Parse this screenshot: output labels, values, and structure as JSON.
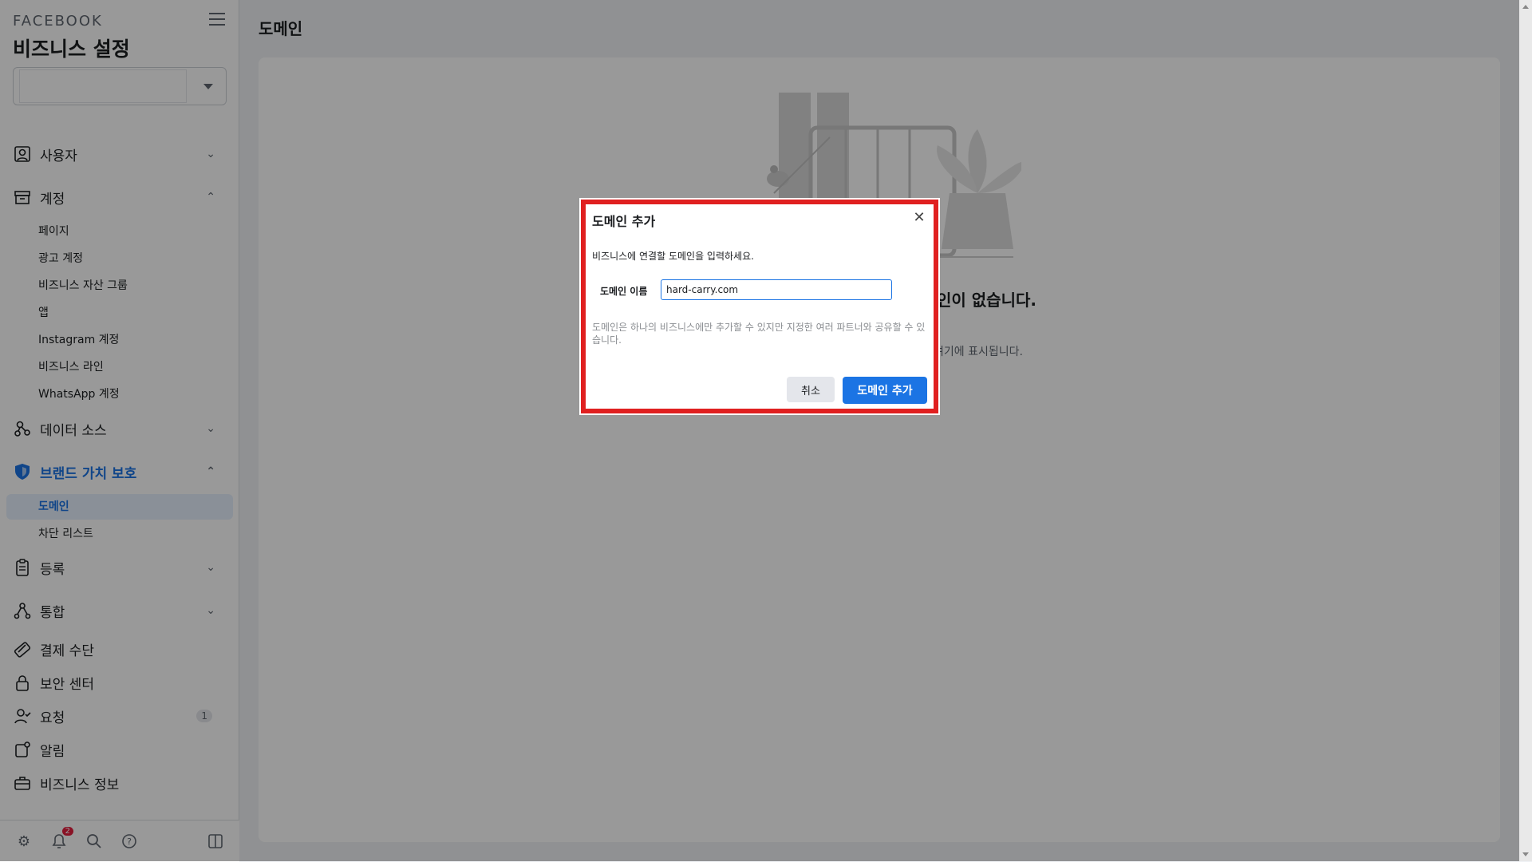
{
  "sidebar": {
    "brand": "FACEBOOK",
    "title": "비즈니스 설정",
    "groups": [
      {
        "label": "사용자",
        "icon": "users-icon",
        "expanded": false
      },
      {
        "label": "계정",
        "icon": "inbox-icon",
        "expanded": true,
        "items": [
          "페이지",
          "광고 계정",
          "비즈니스 자산 그룹",
          "앱",
          "Instagram 계정",
          "비즈니스 라인",
          "WhatsApp 계정"
        ]
      },
      {
        "label": "데이터 소스",
        "icon": "data-sources-icon",
        "expanded": false
      },
      {
        "label": "브랜드 가치 보호",
        "icon": "shield-icon",
        "expanded": true,
        "items": [
          "도메인",
          "차단 리스트"
        ]
      },
      {
        "label": "등록",
        "icon": "clipboard-icon",
        "expanded": false
      },
      {
        "label": "통합",
        "icon": "integrations-icon",
        "expanded": false
      }
    ],
    "links": [
      {
        "label": "결제 수단",
        "icon": "card-icon"
      },
      {
        "label": "보안 센터",
        "icon": "lock-icon"
      },
      {
        "label": "요청",
        "icon": "request-icon",
        "badge": "1"
      },
      {
        "label": "알림",
        "icon": "notification-icon"
      },
      {
        "label": "비즈니스 정보",
        "icon": "briefcase-icon"
      }
    ],
    "footer_notif_badge": "2"
  },
  "main": {
    "title": "도메인",
    "empty_title": "인이 없습니다.",
    "empty_sub": "여기에 표시됩니다."
  },
  "dialog": {
    "title": "도메인 추가",
    "description": "비즈니스에 연결할 도메인을 입력하세요.",
    "field_label": "도메인 이름",
    "field_value": "hard-carry.com",
    "note": "도메인은 하나의 비즈니스에만 추가할 수 있지만 지정한 여러 파트너와 공유할 수 있습니다.",
    "cancel_label": "취소",
    "add_label": "도메인 추가"
  },
  "colors": {
    "accent": "#1b74e4",
    "highlight_border": "#e02020"
  }
}
